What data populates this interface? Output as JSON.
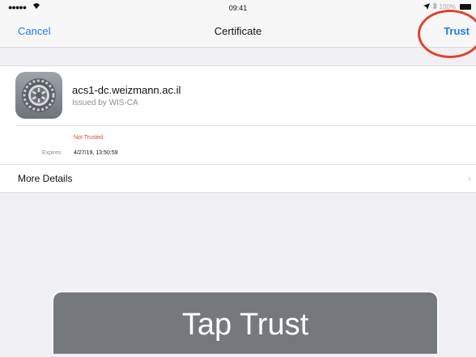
{
  "status_bar": {
    "signal": "●●●●●",
    "time": "09:41",
    "battery_text": "100%"
  },
  "nav": {
    "cancel_label": "Cancel",
    "title": "Certificate",
    "trust_label": "Trust"
  },
  "certificate": {
    "name": "acs1-dc.weizmann.ac.il",
    "issuer": "Issued by WIS-CA",
    "trust_status": "Not Trusted",
    "expires_label": "Expires",
    "expires_value": "4/27/19, 13:50:59"
  },
  "more_details_label": "More Details",
  "overlay": {
    "caption": "Tap Trust"
  },
  "colors": {
    "accent": "#1a7cf4",
    "warning": "#d9443a",
    "highlight_circle": "#e0432c"
  },
  "icons": [
    "wifi-icon",
    "location-icon",
    "bluetooth-icon",
    "battery-icon",
    "settings-gear-icon",
    "chevron-right-icon"
  ]
}
